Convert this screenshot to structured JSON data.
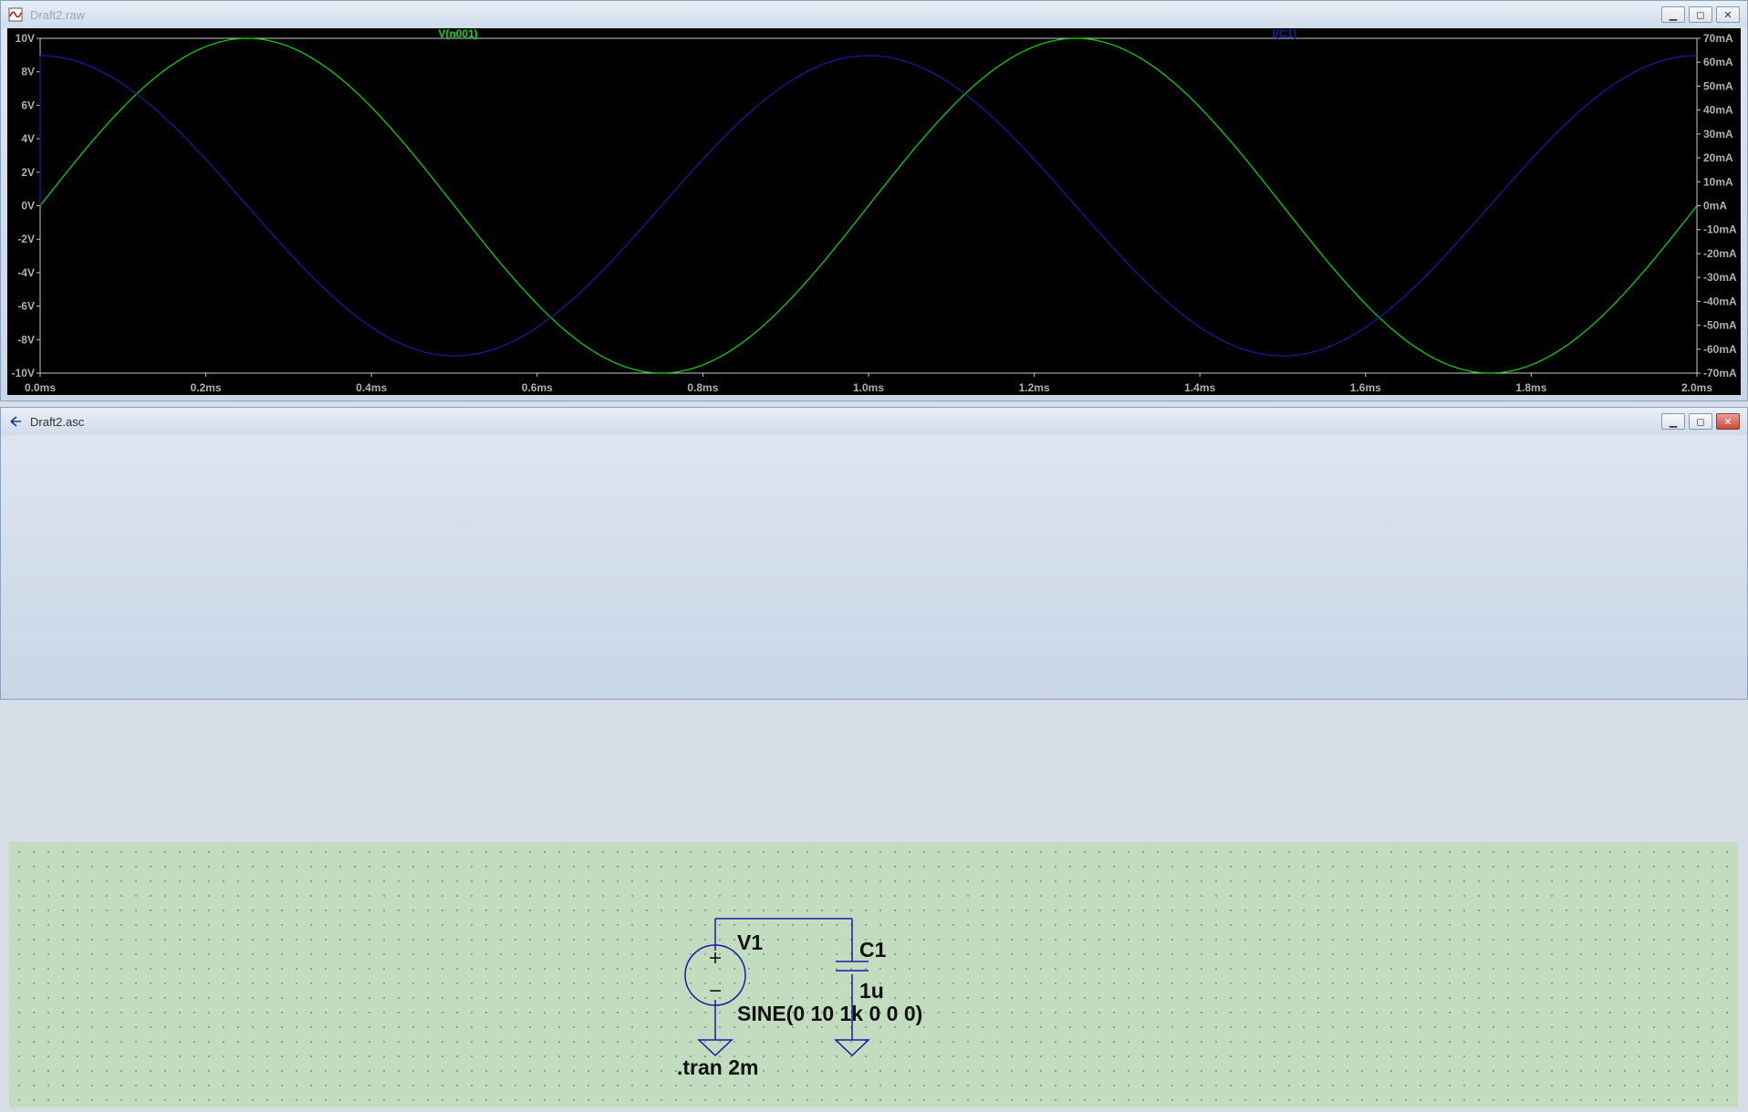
{
  "waveform_window": {
    "title": "Draft2.raw",
    "controls": [
      "minimize",
      "maximize",
      "close"
    ]
  },
  "schematic_window": {
    "title": "Draft2.asc",
    "controls": [
      "minimize",
      "maximize",
      "close"
    ]
  },
  "chart_data": {
    "type": "line",
    "x_axis": {
      "ticks": [
        "0.0ms",
        "0.2ms",
        "0.4ms",
        "0.6ms",
        "0.8ms",
        "1.0ms",
        "1.2ms",
        "1.4ms",
        "1.6ms",
        "1.8ms",
        "2.0ms"
      ],
      "xlim": [
        0,
        2.0
      ],
      "unit": "ms"
    },
    "y_left": {
      "ticks": [
        "10V",
        "8V",
        "6V",
        "4V",
        "2V",
        "0V",
        "-2V",
        "-4V",
        "-6V",
        "-8V",
        "-10V"
      ],
      "ylim": [
        -10,
        10
      ]
    },
    "y_right": {
      "ticks": [
        "70mA",
        "60mA",
        "50mA",
        "40mA",
        "30mA",
        "20mA",
        "10mA",
        "0mA",
        "-10mA",
        "-20mA",
        "-30mA",
        "-40mA",
        "-50mA",
        "-60mA",
        "-70mA"
      ],
      "ylim": [
        -70,
        70
      ]
    },
    "series": [
      {
        "name": "V(n001)",
        "color": "#00e000",
        "axis": "left",
        "amplitude": 10,
        "frequency_khz": 1,
        "phase": "sine"
      },
      {
        "name": "I(C1)",
        "color": "#1a1aa8",
        "axis": "right",
        "amplitude": 62.8,
        "frequency_khz": 1,
        "phase": "cosine"
      }
    ],
    "grid": false
  },
  "schematic": {
    "source_name": "V1",
    "source_value": "SINE(0 10 1k 0 0 0)",
    "cap_name": "C1",
    "cap_value": "1u",
    "directive": ".tran 2m",
    "plus_sign": "+",
    "minus_sign": "−"
  },
  "colors": {
    "wire": "#1a1aa8",
    "plot_bg": "#000000",
    "schematic_bg": "#c2dcbf"
  }
}
